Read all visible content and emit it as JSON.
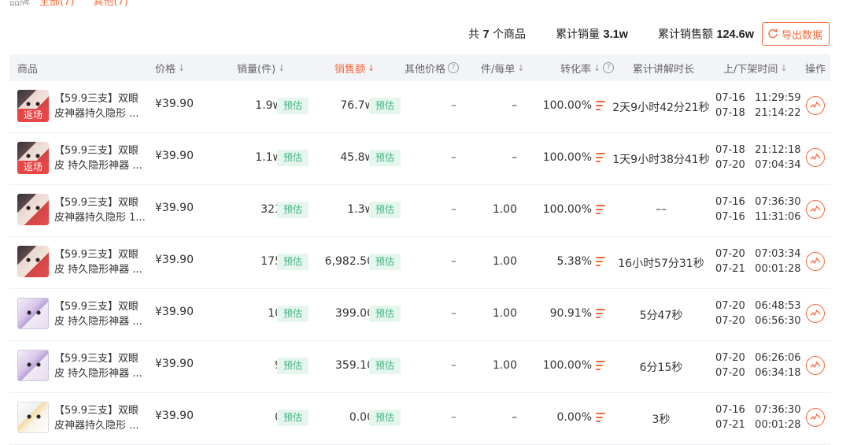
{
  "breadcrumb": {
    "root": "品牌",
    "active": "全部(7)",
    "other": "其他(7)"
  },
  "summary": {
    "count_prefix": "共",
    "count": "7",
    "count_suffix": "个商品",
    "sales_label": "累计销量",
    "sales_value": "3.1w",
    "revenue_label": "累计销售额",
    "revenue_value": "124.6w",
    "export_label": "导出数据"
  },
  "columns": {
    "product": "商品",
    "price": "价格",
    "sales": "销量(件)",
    "amount": "销售额",
    "other_price": "其他价格",
    "per_order": "件/每单",
    "conversion": "转化率",
    "explain_time": "累计讲解时长",
    "shelf_time": "上/下架时间",
    "action": "操作"
  },
  "estimate_label": "预估",
  "rows": [
    {
      "title": "【59.9三支】双眼皮神器持久隐形 ...",
      "tag": "返场",
      "thumb": "red",
      "price": "¥39.90",
      "sales": "1.9w",
      "amount": "76.7w",
      "other_price": "–",
      "per_order": "–",
      "conversion": "100.00%",
      "duration": "2天9小时42分21秒",
      "on_time": "07-16   11:29:59",
      "off_time": "07-18   21:14:22"
    },
    {
      "title": "【59.9三支】双眼皮 持久隐形神器 ...",
      "tag": "返场",
      "thumb": "red",
      "price": "¥39.90",
      "sales": "1.1w",
      "amount": "45.8w",
      "other_price": "–",
      "per_order": "–",
      "conversion": "100.00%",
      "duration": "1天9小时38分41秒",
      "on_time": "07-18   21:12:18",
      "off_time": "07-20   07:04:34"
    },
    {
      "title": "【59.9三支】双眼皮神器持久隐形 1...",
      "tag": "",
      "thumb": "red",
      "price": "¥39.90",
      "sales": "323",
      "amount": "1.3w",
      "other_price": "–",
      "per_order": "1.00",
      "conversion": "100.00%",
      "duration": "––",
      "on_time": "07-16   07:36:30",
      "off_time": "07-16   11:31:06"
    },
    {
      "title": "【59.9三支】双眼皮 持久隐形神器 ...",
      "tag": "",
      "thumb": "red",
      "price": "¥39.90",
      "sales": "175",
      "amount": "6,982.50",
      "other_price": "–",
      "per_order": "1.00",
      "conversion": "5.38%",
      "duration": "16小时57分31秒",
      "on_time": "07-20   07:03:34",
      "off_time": "07-21   00:01:28"
    },
    {
      "title": "【59.9三支】双眼皮 持久隐形神器 ...",
      "tag": "",
      "thumb": "purple",
      "price": "¥39.90",
      "sales": "10",
      "amount": "399.00",
      "other_price": "–",
      "per_order": "1.00",
      "conversion": "90.91%",
      "duration": "5分47秒",
      "on_time": "07-20   06:48:53",
      "off_time": "07-20   06:56:30"
    },
    {
      "title": "【59.9三支】双眼皮 持久隐形神器 ...",
      "tag": "",
      "thumb": "purple",
      "price": "¥39.90",
      "sales": "9",
      "amount": "359.10",
      "other_price": "–",
      "per_order": "1.00",
      "conversion": "100.00%",
      "duration": "6分15秒",
      "on_time": "07-20   06:26:06",
      "off_time": "07-20   06:34:18"
    },
    {
      "title": "【59.9三支】双眼皮神器持久隐形 ...",
      "tag": "",
      "thumb": "white",
      "price": "¥39.90",
      "sales": "0",
      "amount": "0.00",
      "other_price": "–",
      "per_order": "–",
      "conversion": "0.00%",
      "duration": "3秒",
      "on_time": "07-16   07:36:30",
      "off_time": "07-21   00:01:28"
    }
  ],
  "colors": {
    "accent": "#f56a3a",
    "estimate_bg": "#e5f6ef",
    "estimate_fg": "#3fb27f",
    "tag_red": "#e84545"
  }
}
